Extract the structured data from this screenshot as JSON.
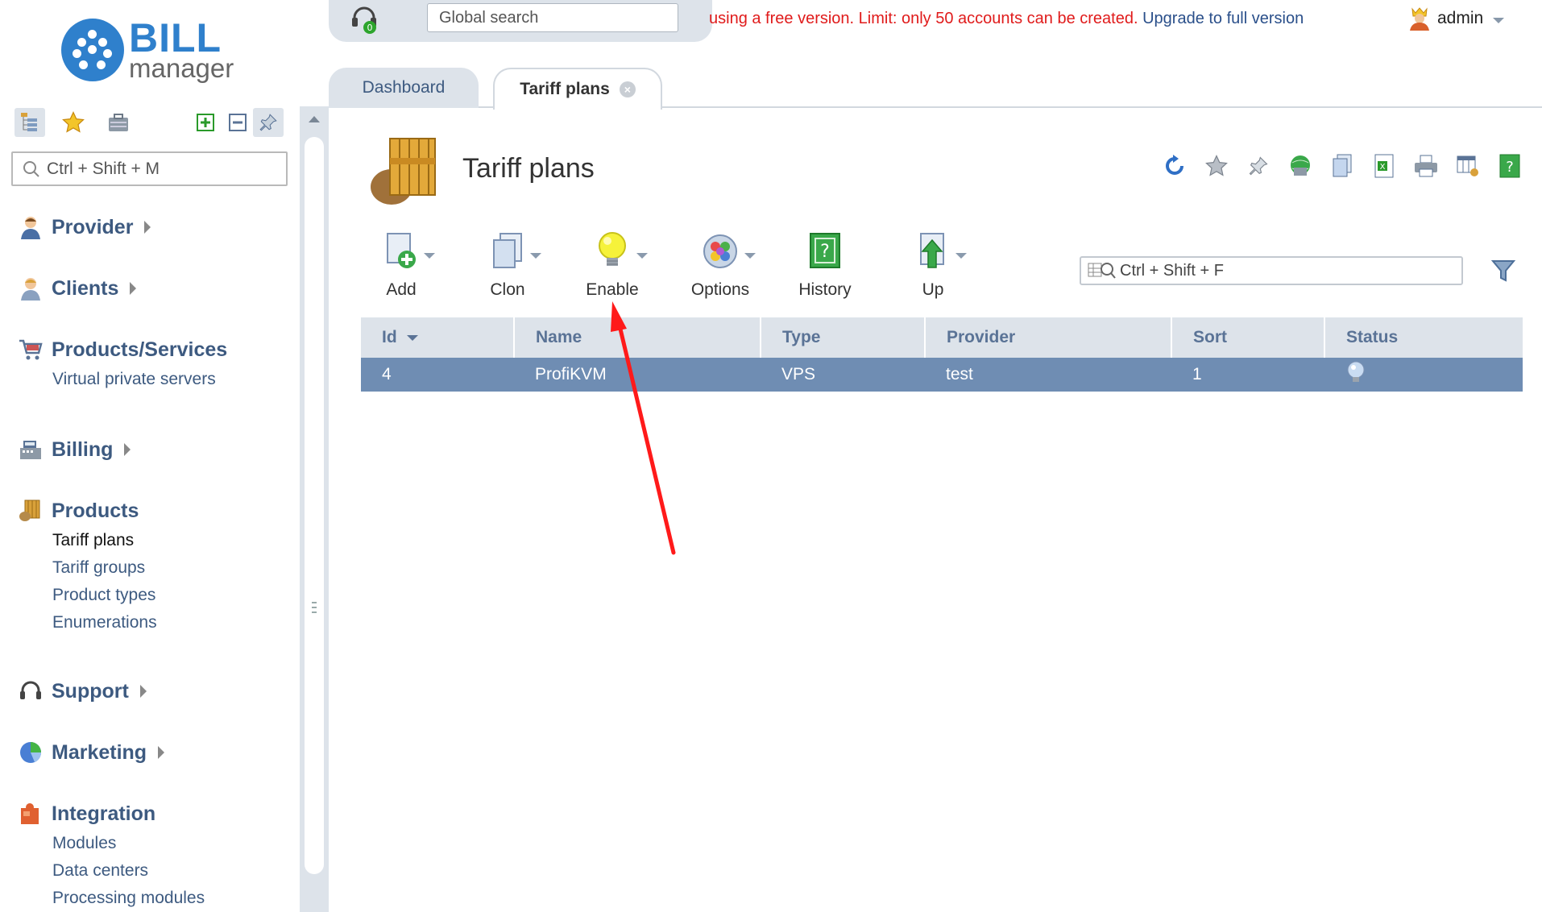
{
  "logo": {
    "line1": "BILL",
    "line2": "manager"
  },
  "sidebar": {
    "search_placeholder": "Ctrl + Shift + M",
    "groups": [
      {
        "label": "Provider",
        "icon": "provider-icon",
        "has_arrow": true,
        "items": []
      },
      {
        "label": "Clients",
        "icon": "clients-icon",
        "has_arrow": true,
        "items": []
      },
      {
        "label": "Products/Services",
        "icon": "cart-icon",
        "has_arrow": false,
        "items": [
          "Virtual private servers"
        ]
      },
      {
        "label": "Billing",
        "icon": "cash-register-icon",
        "has_arrow": true,
        "items": []
      },
      {
        "label": "Products",
        "icon": "products-icon",
        "has_arrow": false,
        "items": [
          "Tariff plans",
          "Tariff groups",
          "Product types",
          "Enumerations"
        ]
      },
      {
        "label": "Support",
        "icon": "headset-icon",
        "has_arrow": true,
        "items": []
      },
      {
        "label": "Marketing",
        "icon": "pie-chart-icon",
        "has_arrow": true,
        "items": []
      },
      {
        "label": "Integration",
        "icon": "puzzle-icon",
        "has_arrow": false,
        "items": [
          "Modules",
          "Data centers",
          "Processing modules"
        ]
      }
    ]
  },
  "topbar": {
    "global_search_placeholder": "Global search",
    "notification_count": "0",
    "warning_text": "using a free version. Limit: only 50 accounts can be created.",
    "upgrade_link": "Upgrade to full version",
    "user": "admin"
  },
  "tabs": {
    "dashboard": "Dashboard",
    "tariff_plans": "Tariff plans"
  },
  "page": {
    "title": "Tariff plans",
    "list_search_placeholder": "Ctrl + Shift + F",
    "toolbar": {
      "add": "Add",
      "clon": "Clon",
      "enable": "Enable",
      "options": "Options",
      "history": "History",
      "up": "Up"
    }
  },
  "table": {
    "columns": [
      "Id",
      "Name",
      "Type",
      "Provider",
      "Sort",
      "Status"
    ],
    "rows": [
      {
        "id": "4",
        "name": "ProfiKVM",
        "type": "VPS",
        "provider": "test",
        "sort": "1",
        "status": "bulb-off-icon"
      }
    ]
  },
  "colors": {
    "accent": "#2f80cc",
    "nav_text": "#3d5a80",
    "selected_row": "#6f8db3",
    "warning": "#e01b1b",
    "annotation_arrow": "#ff1a1a"
  }
}
